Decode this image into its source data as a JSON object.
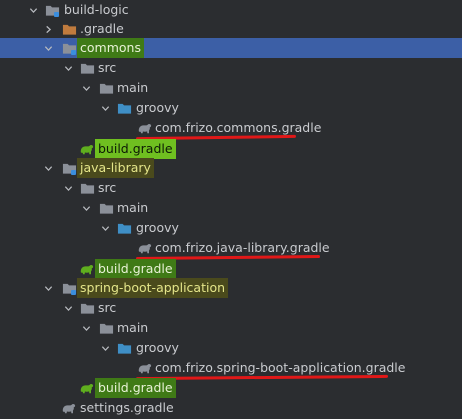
{
  "tree": {
    "items": [
      {
        "label": "build-logic"
      },
      {
        "label": ".gradle"
      },
      {
        "label": "commons"
      },
      {
        "label": "src"
      },
      {
        "label": "main"
      },
      {
        "label": "groovy"
      },
      {
        "label": "com.frizo.commons.gradle"
      },
      {
        "label": "build.gradle"
      },
      {
        "label": "java-library"
      },
      {
        "label": "src"
      },
      {
        "label": "main"
      },
      {
        "label": "groovy"
      },
      {
        "label": "com.frizo.java-library.gradle"
      },
      {
        "label": "build.gradle"
      },
      {
        "label": "spring-boot-application"
      },
      {
        "label": "src"
      },
      {
        "label": "main"
      },
      {
        "label": "groovy"
      },
      {
        "label": "com.frizo.spring-boot-application.gradle"
      },
      {
        "label": "build.gradle"
      },
      {
        "label": "settings.gradle"
      }
    ]
  },
  "colors": {
    "background": "#2b2d30",
    "selection": "#3c5fa6",
    "folder_gray": "#8b9099",
    "folder_orange": "#c07b3e",
    "folder_blue": "#3f8fc6",
    "annotation_red": "#e01818",
    "highlight_green": "#6fbf20",
    "highlight_yellow": "#e4e58a"
  },
  "icons": {
    "expanded": "chevron-down-icon",
    "collapsed": "chevron-right-icon",
    "module": "module-folder-icon",
    "folder": "folder-icon",
    "source_root": "source-folder-icon",
    "excluded": "excluded-folder-icon",
    "gradle": "gradle-elephant-icon"
  }
}
